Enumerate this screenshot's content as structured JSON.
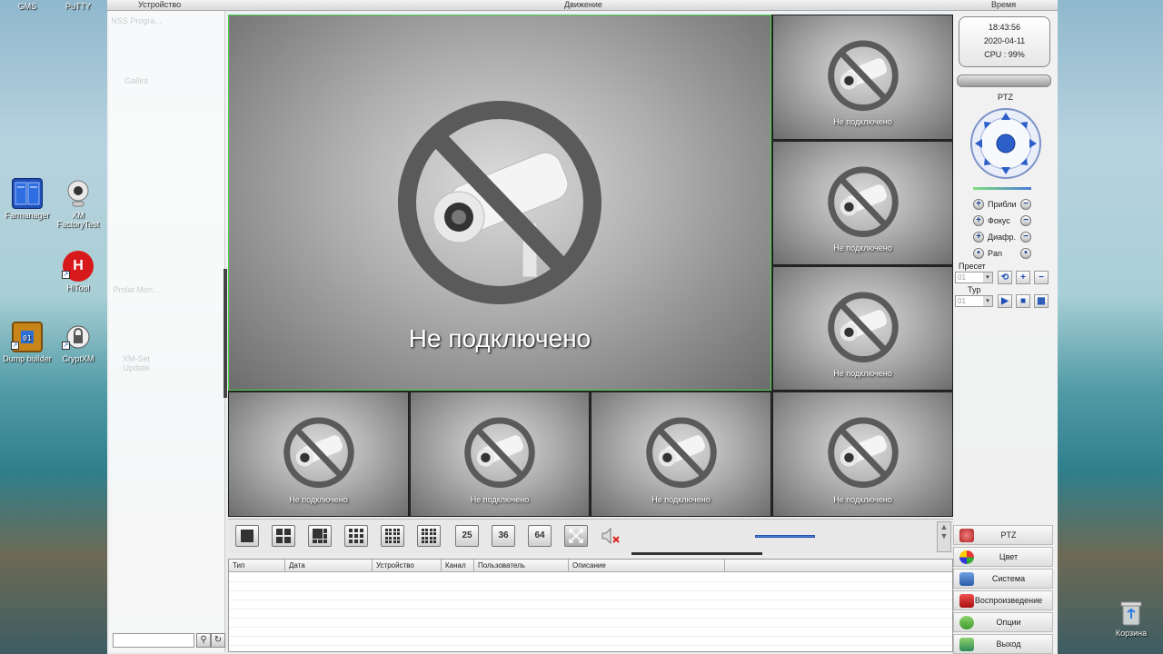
{
  "desktop": {
    "icons": [
      {
        "label": "GMS"
      },
      {
        "label": "PuTTY"
      },
      {
        "label": "Farmanager"
      },
      {
        "label": "XM FactoryTest"
      },
      {
        "label": "HiTool"
      },
      {
        "label": "Dump builder"
      },
      {
        "label": "CryptXM"
      }
    ],
    "recycle_bin": {
      "label": "Корзина"
    }
  },
  "app": {
    "topbar": {
      "device_label": "Устройство",
      "motion_label": "Движение",
      "time_label": "Время"
    },
    "left_panel": {
      "ghost_labels": [
        "NSS Progra...",
        "Gallint",
        "Prolat Mon...",
        "XM-Set Update"
      ]
    },
    "grid": {
      "no_connection_text": "Не подключено",
      "cells": [
        {
          "id": "main",
          "text": "Не подключено",
          "selected": true
        },
        {
          "id": "r1",
          "text": "Не подключено"
        },
        {
          "id": "r2",
          "text": "Не подключено"
        },
        {
          "id": "r3",
          "text": "Не подключено"
        },
        {
          "id": "b1",
          "text": "Не подключено"
        },
        {
          "id": "b2",
          "text": "Не подключено"
        },
        {
          "id": "b3",
          "text": "Не подключено"
        },
        {
          "id": "b4",
          "text": "Не подключено"
        }
      ]
    },
    "toolbar": {
      "layout_buttons": [
        "1",
        "4",
        "6",
        "8",
        "9",
        "16",
        "25",
        "36",
        "64"
      ],
      "label_25": "25",
      "label_36": "36",
      "label_64": "64",
      "volume_level": 1.0
    },
    "event_log": {
      "columns": [
        "Тип",
        "Дата",
        "Устройство",
        "Канал",
        "Пользователь",
        "Описание"
      ]
    },
    "right_panel": {
      "clock": {
        "time": "18:43:56",
        "date": "2020-04-11",
        "cpu": "CPU : 99%"
      },
      "ptz": {
        "title": "PTZ",
        "zoom": "Прибли",
        "focus": "Фокус",
        "iris": "Диафр.",
        "pan": "Pan",
        "preset_label": "Пресет",
        "preset_value": "01",
        "tour_label": "Тур",
        "tour_value": "01"
      },
      "menu": {
        "ptz": "PTZ",
        "color": "Цвет",
        "system": "Система",
        "playback": "Воспроизведение",
        "options": "Опции",
        "exit": "Выход"
      }
    }
  }
}
